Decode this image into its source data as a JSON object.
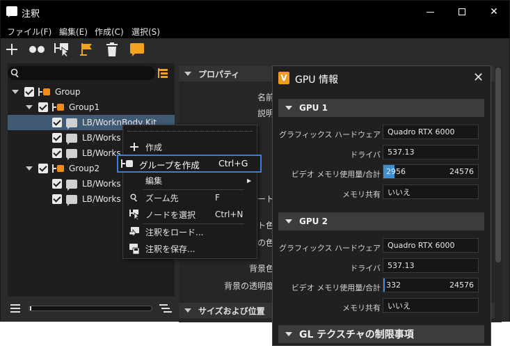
{
  "window": {
    "title": "注釈"
  },
  "menubar": [
    "ファイル(F)",
    "編集(E)",
    "作成(C)",
    "選択(S)"
  ],
  "tree": [
    {
      "label": "Group",
      "level": 0,
      "kind": "group",
      "expanded": true
    },
    {
      "label": "Group1",
      "level": 1,
      "kind": "group",
      "expanded": true
    },
    {
      "label": "LB/WorknBody Kit",
      "level": 2,
      "kind": "note",
      "selected": true
    },
    {
      "label": "LB/Works E",
      "level": 2,
      "kind": "note"
    },
    {
      "label": "LB/Works E",
      "level": 2,
      "kind": "note"
    },
    {
      "label": "Group2",
      "level": 1,
      "kind": "group",
      "expanded": true
    },
    {
      "label": "LB/Works E",
      "level": 2,
      "kind": "note"
    },
    {
      "label": "LB/Works E",
      "level": 2,
      "kind": "note"
    }
  ],
  "properties": {
    "section_title": "プロパティ",
    "labels": [
      "名前",
      "説明",
      "ート",
      "ト色",
      "の色",
      "背景色",
      "背景の透明度"
    ],
    "section2_title": "サイズおよび位置"
  },
  "context_menu": {
    "items": [
      {
        "label": "作成",
        "icon": "plus-icon"
      },
      {
        "label": "グループを作成",
        "shortcut": "Ctrl+G",
        "icon": "group-icon",
        "highlight": true
      },
      {
        "label": "編集",
        "submenu": true
      },
      {
        "label": "ズーム先",
        "shortcut": "F",
        "icon": "search-icon"
      },
      {
        "label": "ノードを選択",
        "shortcut": "Ctrl+N",
        "icon": "select-node-icon"
      },
      {
        "label": "注釈をロード...",
        "icon": "load-note-icon"
      },
      {
        "label": "注釈を保存...",
        "icon": "save-note-icon"
      }
    ]
  },
  "gpu_dialog": {
    "title": "GPU 情報",
    "gpus": [
      {
        "name": "GPU 1",
        "graphics_hardware_label": "グラフィックス ハードウェア",
        "graphics_hardware": "Quadro RTX 6000",
        "driver_label": "ドライバ",
        "driver": "537.13",
        "vram_label": "ビデオ メモリ使用量/合計",
        "vram_used": "2956",
        "vram_total": "24576",
        "vram_fraction": 0.12,
        "shared_label": "メモリ共有",
        "shared": "いいえ"
      },
      {
        "name": "GPU 2",
        "graphics_hardware_label": "グラフィックス ハードウェア",
        "graphics_hardware": "Quadro RTX 6000",
        "driver_label": "ドライバ",
        "driver": "537.13",
        "vram_label": "ビデオ メモリ使用量/合計",
        "vram_used": "332",
        "vram_total": "24576",
        "vram_fraction": 0.014,
        "shared_label": "メモリ共有",
        "shared": "いいえ"
      }
    ],
    "gl_section": "GL テクスチャの制限事項"
  },
  "colors": {
    "accent": "#3b7fd6",
    "group_orange": "#f28c1a",
    "vram_bar": "#3d8fd4"
  }
}
